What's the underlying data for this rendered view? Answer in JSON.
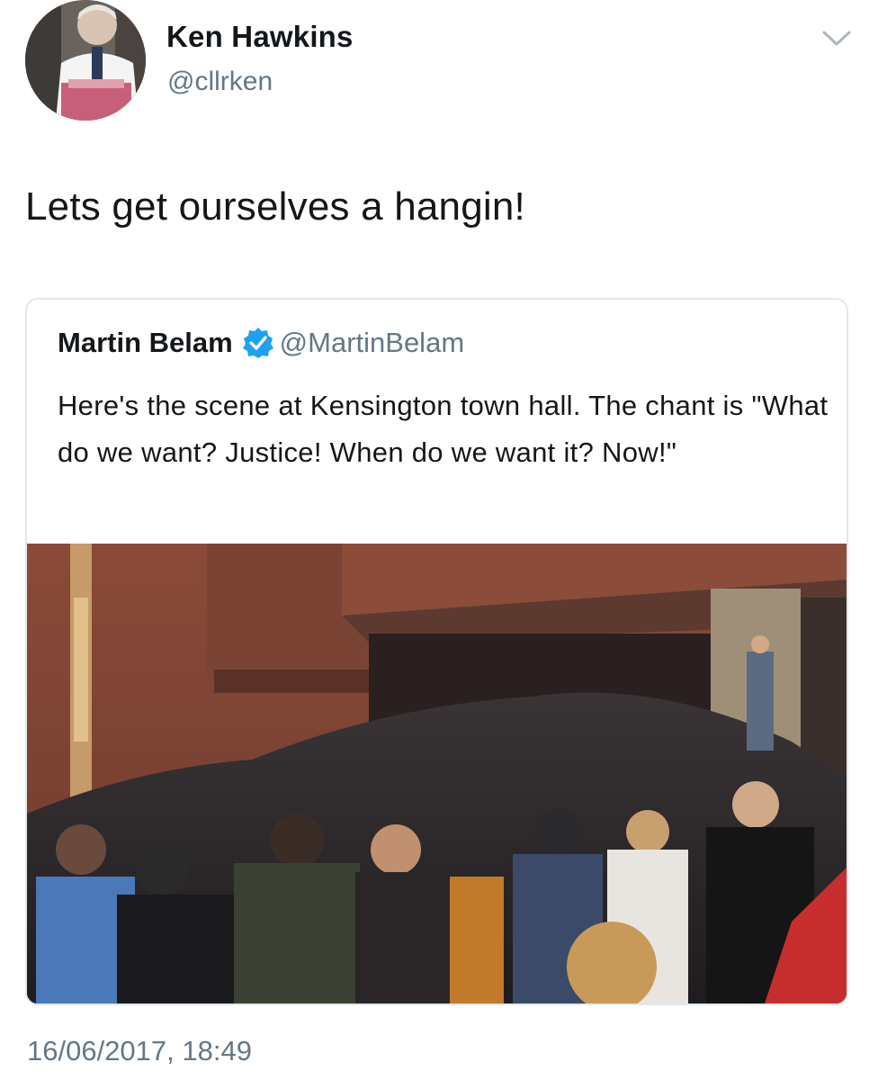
{
  "tweet": {
    "author": {
      "name": "Ken Hawkins",
      "handle": "@cllrken"
    },
    "text": "Lets get ourselves a hangin!",
    "timestamp": "16/06/2017, 18:49",
    "icons": {
      "menu": "chevron-down-icon",
      "avatar": "profile-photo"
    }
  },
  "quoted_tweet": {
    "author": {
      "name": "Martin Belam",
      "handle": "@MartinBelam",
      "verified": true
    },
    "text": "Here's the scene at Kensington town hall. The chant is \"What do we want? Justice! When do we want it? Now!\"",
    "media": {
      "type": "photo"
    }
  },
  "colors": {
    "primary_text": "#14171a",
    "secondary_text": "#657786",
    "verified_blue": "#1da1f2",
    "card_border": "#e1e8ed"
  }
}
